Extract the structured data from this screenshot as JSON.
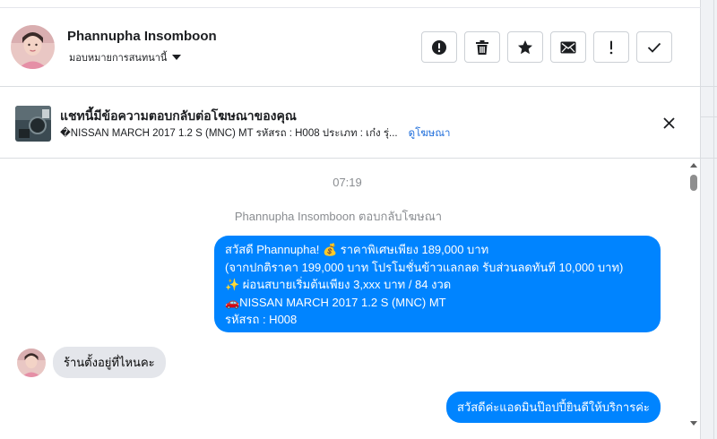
{
  "header": {
    "name": "Phannupha Insomboon",
    "assign_label": "มอบหมายการสนทนานี้",
    "actions": [
      {
        "icon": "alert-circle-icon",
        "name": "mark-spam-button"
      },
      {
        "icon": "trash-icon",
        "name": "delete-button"
      },
      {
        "icon": "star-icon",
        "name": "star-button"
      },
      {
        "icon": "envelope-icon",
        "name": "mark-unread-button"
      },
      {
        "icon": "exclamation-icon",
        "name": "follow-up-button"
      },
      {
        "icon": "check-icon",
        "name": "mark-done-button"
      }
    ]
  },
  "ad_banner": {
    "title": "แชทนี้มีข้อความตอบกลับต่อโฆษณาของคุณ",
    "subtitle": "�NISSAN MARCH 2017 1.2 S (MNC) MT รหัสรถ : H008 ประเภท : เก๋ง รุ่...",
    "link": "ดูโฆษณา"
  },
  "thread": {
    "timestamp": "07:19",
    "reply_note": "Phannupha Insomboon ตอบกลับโฆษณา",
    "outgoing_1": {
      "lines": [
        "สวัสดี Phannupha! 💰 ราคาพิเศษเพียง 189,000 บาท",
        "(จากปกติราคา 199,000 บาท โปรโมชั่นข้าวแลกลด รับส่วนลดทันที 10,000 บาท)",
        "✨ ผ่อนสบายเริ่มต้นเพียง 3,xxx บาท / 84 งวด",
        "🚗NISSAN MARCH 2017 1.2 S (MNC) MT",
        "รหัสรถ : H008"
      ]
    },
    "incoming_1": "ร้านตั้งอยู่ที่ไหนคะ",
    "outgoing_2": "สวัสดีค่ะแอดมินป๊อปปี้ยินดีให้บริการค่ะ"
  },
  "colors": {
    "outgoing_bubble": "#0084ff",
    "incoming_bubble": "#e4e6eb",
    "link": "#216fdb",
    "meta_text": "#8a8d91"
  }
}
